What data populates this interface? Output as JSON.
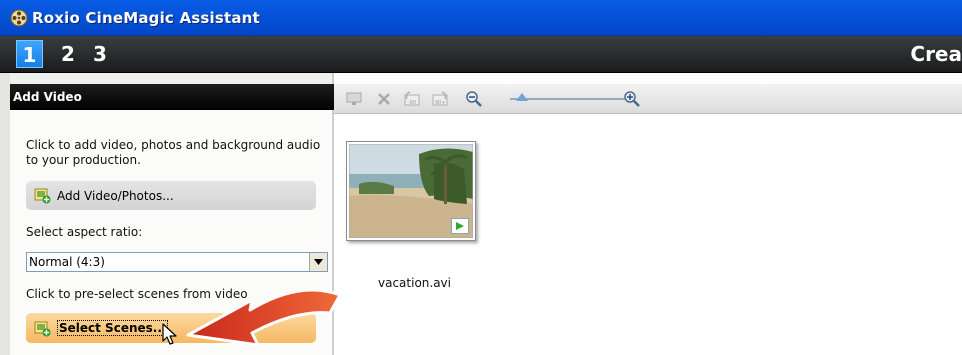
{
  "window": {
    "title": "Roxio CineMagic Assistant",
    "icon": "film-reel-icon"
  },
  "steps": {
    "items": [
      "1",
      "2",
      "3"
    ],
    "active": "1",
    "heading": "Crea"
  },
  "left_panel": {
    "header": "Add Video",
    "intro_text": "Click to add video, photos and background audio to your production.",
    "add_button_label": "Add Video/Photos...",
    "aspect_label": "Select aspect ratio:",
    "aspect_value": "Normal (4:3)",
    "preselect_text": "Click to pre-select scenes from video",
    "select_scenes_label": "Select Scenes..."
  },
  "toolbar": {
    "icons": [
      "monitor-icon",
      "delete-icon",
      "rotate-left-90-icon",
      "rotate-right-90-icon",
      "zoom-out-icon",
      "zoom-slider",
      "zoom-in-icon"
    ],
    "rotate_left_label": "-90",
    "rotate_right_label": "90+"
  },
  "media": {
    "items": [
      {
        "filename": "vacation.avi",
        "thumbnail": "beach-scene",
        "play_icon": "play-icon"
      }
    ]
  },
  "colors": {
    "titlebar": "#0553d8",
    "step_active": "#1480e6",
    "select_scenes_button": "#f5b862",
    "callout_arrow": "#e03a1f"
  }
}
